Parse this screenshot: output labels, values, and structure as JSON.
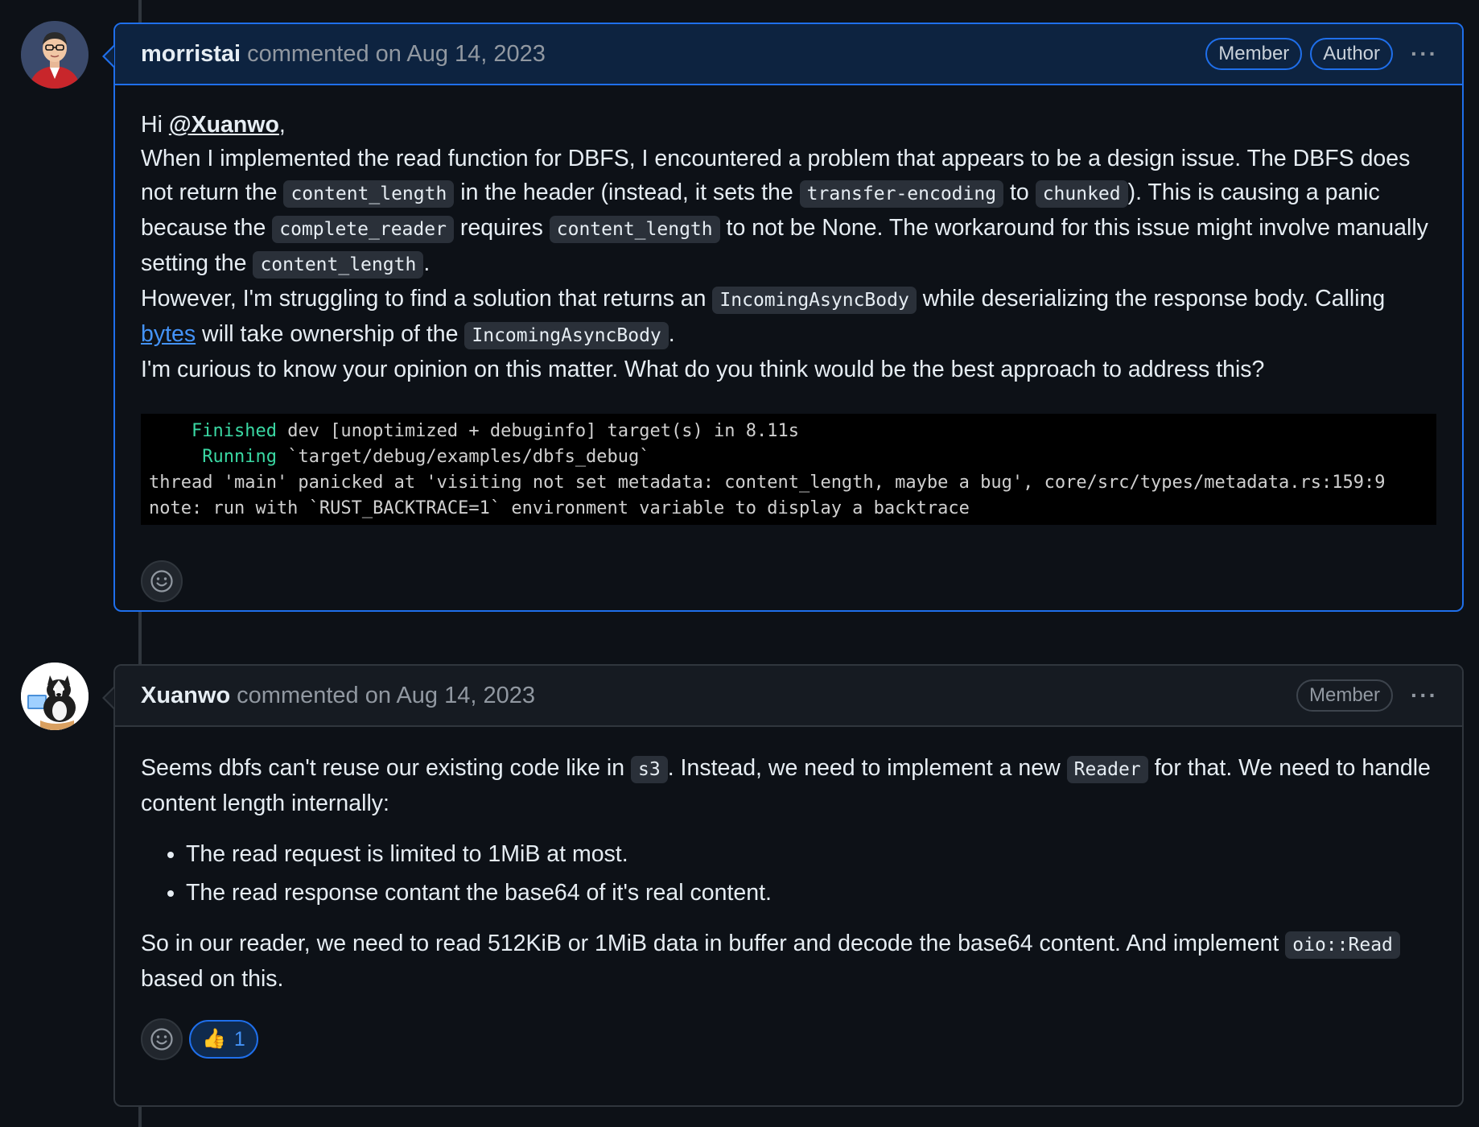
{
  "comments": [
    {
      "author": "morristai",
      "meta": "commented on Aug 14, 2023",
      "badges": [
        "Member",
        "Author"
      ],
      "body": {
        "greeting_prefix": "Hi ",
        "mention": "@Xuanwo",
        "greeting_suffix": ",",
        "p1_a": "When I implemented the read function for DBFS, I encountered a problem that appears to be a design issue. The DBFS does not return the ",
        "code_content_length": "content_length",
        "p1_b": " in the header (instead, it sets the ",
        "code_transfer_encoding": "transfer-encoding",
        "p1_c": " to ",
        "code_chunked": "chunked",
        "p1_d": "). This is causing a panic because the ",
        "code_complete_reader": "complete_reader",
        "p1_e": " requires ",
        "p1_f": " to not be None. The workaround for this issue might involve manually setting the ",
        "p1_g": ".",
        "p2_a": "However, I'm struggling to find a solution that returns an ",
        "code_incoming": "IncomingAsyncBody",
        "p2_b": " while deserializing the response body. Calling ",
        "link_bytes": "bytes",
        "p2_c": " will take ownership of the ",
        "p2_d": ".",
        "p3": "I'm curious to know your opinion on this matter. What do you think would be the best approach to address this?"
      },
      "terminal": {
        "line1_keyword": "Finished",
        "line1_rest": " dev [unoptimized + debuginfo] target(s) in 8.11s",
        "line2_keyword": "Running",
        "line2_rest": " `target/debug/examples/dbfs_debug`",
        "line3": "thread 'main' panicked at 'visiting not set metadata: content_length, maybe a bug', core/src/types/metadata.rs:159:9",
        "line4": "note: run with `RUST_BACKTRACE=1` environment variable to display a backtrace"
      }
    },
    {
      "author": "Xuanwo",
      "meta": "commented on Aug 14, 2023",
      "badges": [
        "Member"
      ],
      "body": {
        "p1_a": "Seems dbfs can't reuse our existing code like in ",
        "code_s3": "s3",
        "p1_b": ". Instead, we need to implement a new ",
        "code_reader": "Reader",
        "p1_c": " for that. We need to handle content length internally:",
        "bullets": [
          "The read request is limited to 1MiB at most.",
          "The read response contant the base64 of it's real content."
        ],
        "p2_a": "So in our reader, we need to read 512KiB or 1MiB data in buffer and decode the base64 content. And implement ",
        "code_oio_read": "oio::Read",
        "p2_b": " based on this."
      },
      "reactions": [
        {
          "emoji_icon": "thumbs-up-icon",
          "emoji": "👍",
          "count": "1"
        }
      ]
    }
  ],
  "colors": {
    "background": "#0d1117",
    "border": "#30363d",
    "author_border": "#1f6feb",
    "link": "#4493f8",
    "terminal_green": "#3ad8a3"
  }
}
